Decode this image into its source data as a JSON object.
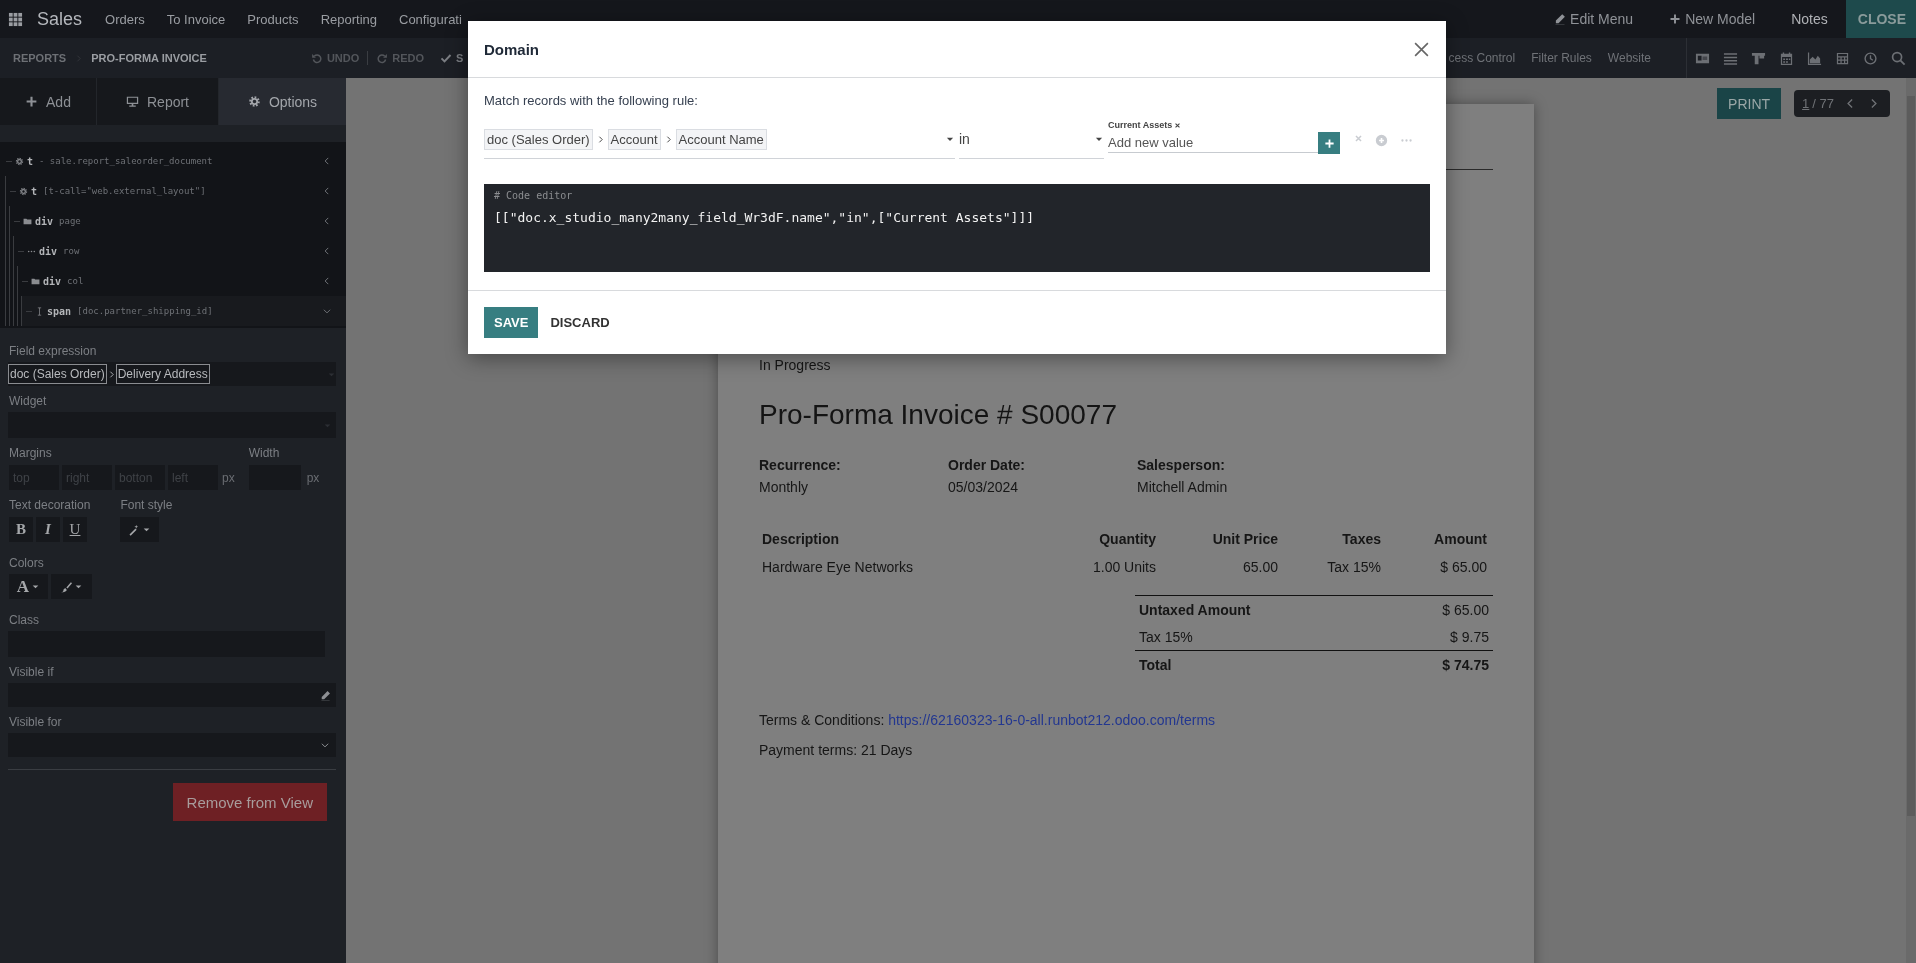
{
  "navbar": {
    "app": "Sales",
    "menus": [
      "Orders",
      "To Invoice",
      "Products",
      "Reporting",
      "Configurati"
    ],
    "actions": [
      {
        "kind": "edit",
        "label": "Edit Menu"
      },
      {
        "kind": "new",
        "label": "New Model"
      },
      {
        "kind": "plain",
        "label": "Notes"
      },
      {
        "kind": "close",
        "label": "CLOSE"
      }
    ]
  },
  "studio_bar": {
    "breadcrumbs": [
      "REPORTS",
      "PRO-FORMA INVOICE"
    ],
    "history": [
      {
        "kind": "undo",
        "label": "UNDO"
      },
      {
        "kind": "redo",
        "label": "REDO"
      },
      {
        "kind": "save",
        "label": "S"
      }
    ],
    "links": [
      "cess Control",
      "Filter Rules",
      "Website"
    ]
  },
  "sidebar": {
    "tabs": [
      {
        "kind": "add",
        "label": "Add",
        "selected": false
      },
      {
        "kind": "report",
        "label": "Report",
        "selected": false
      },
      {
        "kind": "options",
        "label": "Options",
        "selected": true
      }
    ],
    "tree": [
      {
        "kind": "template",
        "tag": "t",
        "attr": "- sale.report_saleorder_document",
        "expanded": false,
        "children": [
          {
            "kind": "template",
            "tag": "t",
            "attr": "[t-call=\"web.external_layout\"]",
            "expanded": false,
            "children": [
              {
                "kind": "folder",
                "tag": "div",
                "attr": "page",
                "expanded": false,
                "children": [
                  {
                    "kind": "dots",
                    "tag": "div",
                    "attr": "row",
                    "expanded": false,
                    "children": [
                      {
                        "kind": "folder",
                        "tag": "div",
                        "attr": "col",
                        "expanded": false,
                        "children": [
                          {
                            "kind": "text",
                            "tag": "span",
                            "attr": "[doc.partner_shipping_id]",
                            "expanded": true
                          }
                        ]
                      }
                    ]
                  }
                ]
              }
            ]
          }
        ]
      }
    ],
    "field_expression": {
      "label": "Field expression",
      "path": [
        "doc (Sales Order)",
        "Delivery Address"
      ]
    },
    "widget": {
      "label": "Widget"
    },
    "margins": {
      "label": "Margins",
      "placeholders": [
        "top",
        "right",
        "botton",
        "left"
      ],
      "unit": "px"
    },
    "width": {
      "label": "Width",
      "unit": "px"
    },
    "text_decoration": {
      "label": "Text decoration",
      "buttons": [
        "B",
        "I",
        "U"
      ]
    },
    "font_style": {
      "label": "Font style"
    },
    "colors": {
      "label": "Colors",
      "text_color": "A"
    },
    "class": {
      "label": "Class"
    },
    "visible_if": {
      "label": "Visible if"
    },
    "visible_for": {
      "label": "Visible for"
    },
    "remove_button": "Remove from View"
  },
  "report_view": {
    "print_button": "PRINT",
    "pager": {
      "value": "1",
      "limit": "/ 77"
    },
    "report": {
      "status": "In Progress",
      "title": "Pro-Forma Invoice # S00077",
      "info": [
        {
          "label": "Recurrence:",
          "value": "Monthly"
        },
        {
          "label": "Order Date:",
          "value": "05/03/2024"
        },
        {
          "label": "Salesperson:",
          "value": "Mitchell Admin"
        }
      ],
      "table": {
        "columns": [
          "Description",
          "Quantity",
          "Unit Price",
          "Taxes",
          "Amount"
        ],
        "rows": [
          [
            "Hardware Eye Networks",
            "1.00 Units",
            "65.00",
            "Tax 15%",
            "$ 65.00"
          ]
        ]
      },
      "totals": [
        {
          "kind": "subtotal",
          "label": "Untaxed Amount",
          "value": "$ 65.00"
        },
        {
          "kind": "tax",
          "label": "Tax 15%",
          "value": "$ 9.75"
        },
        {
          "kind": "total",
          "label": "Total",
          "value": "$ 74.75"
        }
      ],
      "terms": {
        "label": "Terms & Conditions:",
        "link": "https://62160323-16-0-all.runbot212.odoo.com/terms"
      },
      "payment_terms": "Payment terms: 21 Days"
    }
  },
  "dialog": {
    "title": "Domain",
    "intro": "Match records with the following rule:",
    "rule": {
      "path": [
        "doc (Sales Order)",
        "Account",
        "Account Name"
      ],
      "operator": "in",
      "values": [
        "Current Assets"
      ],
      "placeholder": "Add new value"
    },
    "code_comment": "# Code editor",
    "code": "[[\"doc.x_studio_many2many_field_Wr3dF.name\",\"in\",[\"Current Assets\"]]]",
    "buttons": [
      {
        "kind": "primary",
        "label": "SAVE"
      },
      {
        "kind": "secondary",
        "label": "DISCARD"
      }
    ]
  }
}
